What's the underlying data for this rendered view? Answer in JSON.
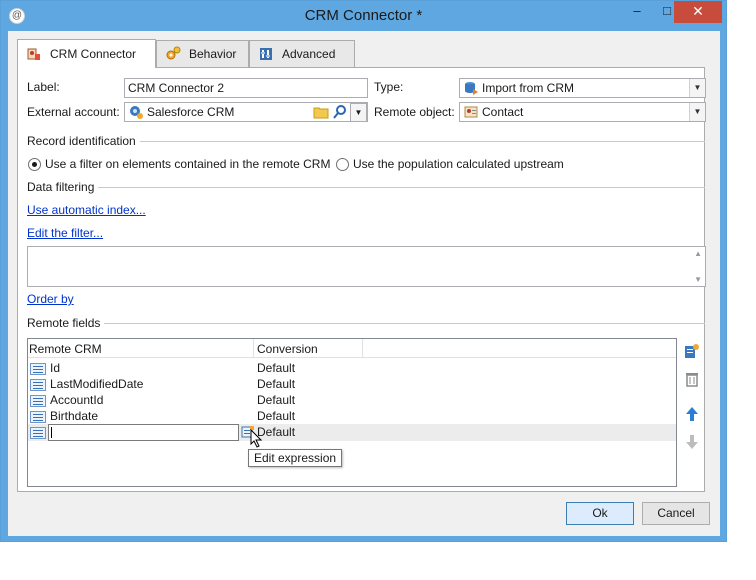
{
  "window": {
    "title": "CRM Connector *",
    "minimize_glyph": "–",
    "maximize_glyph": "□",
    "close_glyph": "✕",
    "app_icon_glyph": "@"
  },
  "tabs": [
    {
      "label": "CRM Connector",
      "icon": "crm-connector-icon",
      "active": true
    },
    {
      "label": "Behavior",
      "icon": "gears-icon",
      "active": false
    },
    {
      "label": "Advanced",
      "icon": "advanced-settings-icon",
      "active": false
    }
  ],
  "form": {
    "label_caption": "Label:",
    "label_value": "CRM Connector 2",
    "type_caption": "Type:",
    "type_value": "Import from CRM",
    "external_account_caption": "External account:",
    "external_account_value": "Salesforce CRM",
    "remote_object_caption": "Remote object:",
    "remote_object_value": "Contact"
  },
  "record_identification": {
    "title": "Record identification",
    "option_filter": "Use a filter on elements contained in the remote CRM",
    "option_population": "Use the population calculated upstream",
    "selected": "option_filter"
  },
  "data_filtering": {
    "title": "Data filtering",
    "use_auto_index": "Use automatic index...",
    "edit_filter": "Edit the filter...",
    "filter_text": ""
  },
  "order_by": "Order by",
  "remote_fields": {
    "title": "Remote fields",
    "columns": [
      "Remote CRM",
      "Conversion"
    ],
    "rows": [
      {
        "remote": "Id",
        "conversion": "Default"
      },
      {
        "remote": "LastModifiedDate",
        "conversion": "Default"
      },
      {
        "remote": "AccountId",
        "conversion": "Default"
      },
      {
        "remote": "Birthdate",
        "conversion": "Default"
      },
      {
        "remote": "",
        "conversion": "Default"
      }
    ],
    "tooltip": "Edit expression"
  },
  "buttons": {
    "ok": "Ok",
    "cancel": "Cancel"
  },
  "colors": {
    "titlebar": "#5fa7e0",
    "close": "#c74c3c",
    "link": "#0033cc"
  }
}
